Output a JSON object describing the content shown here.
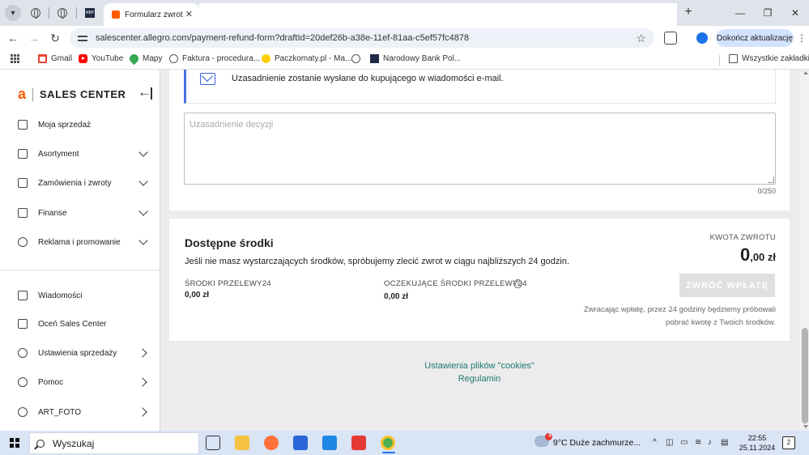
{
  "browser": {
    "active_tab_title": "Formularz zwrotu",
    "url": "salescenter.allegro.com/payment-refund-form?draftId=20def26b-a38e-11ef-81aa-c5ef57fc4878",
    "update_button": "Dokończ aktualizację",
    "bookmarks": [
      "Gmail",
      "YouTube",
      "Mapy",
      "Faktura - procedura...",
      "Paczkomaty.pl - Ma...",
      "Narodowy Bank Pol..."
    ],
    "other_bookmarks": "Wszystkie zakładki"
  },
  "sidebar": {
    "logo_letter": "a",
    "logo_text": "SALES CENTER",
    "top_items": [
      {
        "label": "Moja sprzedaż"
      },
      {
        "label": "Asortyment"
      },
      {
        "label": "Zamówienia i zwroty"
      },
      {
        "label": "Finanse"
      },
      {
        "label": "Reklama i promowanie"
      }
    ],
    "bottom_items": [
      {
        "label": "Wiadomości"
      },
      {
        "label": "Oceń Sales Center"
      },
      {
        "label": "Ustawienia sprzedaży"
      },
      {
        "label": "Pomoc"
      },
      {
        "label": "ART_FOTO"
      }
    ]
  },
  "justification": {
    "notice": "Uzasadnienie zostanie wysłane do kupującego w wiadomości e-mail.",
    "placeholder": "Uzasadnienie decyzji",
    "char_count": "0/250"
  },
  "funds": {
    "title": "Dostępne środki",
    "description": "Jeśli nie masz wystarczających środków, spróbujemy zlecić zwrot w ciągu najbliższych 24 godzin.",
    "p24_label": "ŚRODKI PRZELEWY24",
    "p24_value": "0,00 zł",
    "pending_label": "OCZEKUJĄCE ŚRODKI PRZELEWY24",
    "pending_value": "0,00 zł",
    "amount_label": "KWOTA ZWROTU",
    "amount_major": "0",
    "amount_minor": ",00 zł",
    "refund_button": "ZWRÓĆ WPŁATĘ",
    "refund_note": "Zwracając wpłatę, przez 24 godziny będziemy próbowali pobrać kwotę z Twoich środków."
  },
  "footer": {
    "cookies_link": "Ustawienia plików \"cookies\"",
    "terms_link": "Regulamin"
  },
  "taskbar": {
    "search_placeholder": "Wyszukaj",
    "weather_badge": "1",
    "weather": "9°C  Duże zachmurze...",
    "time": "22:55",
    "date": "25.11.2024",
    "notifications": "2"
  }
}
